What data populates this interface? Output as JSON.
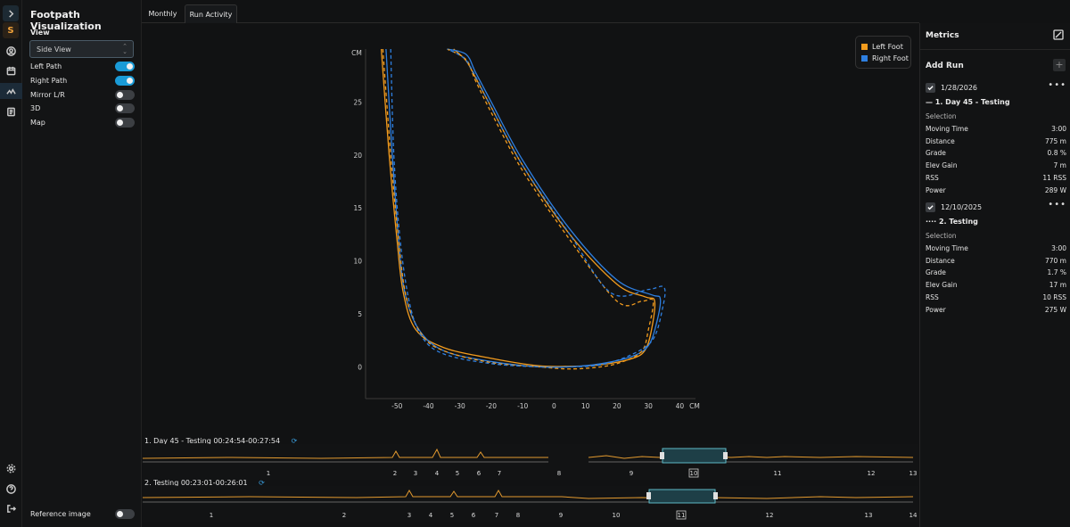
{
  "app": {
    "title": "Footpath Visualization",
    "logo_letter": "S"
  },
  "rail": {
    "top_icons": [
      "expand-icon",
      "logo",
      "user-icon",
      "calendar-icon",
      "activity-icon",
      "notes-icon"
    ],
    "bottom_icons": [
      "settings-icon",
      "help-icon",
      "logout-icon"
    ]
  },
  "view": {
    "label": "View",
    "selected": "Side View"
  },
  "toggles": [
    {
      "label": "Left Path",
      "on": true
    },
    {
      "label": "Right Path",
      "on": true
    },
    {
      "label": "Mirror L/R",
      "on": false
    },
    {
      "label": "3D",
      "on": false
    },
    {
      "label": "Map",
      "on": false
    }
  ],
  "reference_image": {
    "label": "Reference image",
    "on": false
  },
  "tabs": [
    {
      "label": "Monthly",
      "active": false
    },
    {
      "label": "Run Activity",
      "active": true
    }
  ],
  "chart_data": {
    "type": "line",
    "title": "",
    "xlabel": "CM",
    "ylabel": "CM",
    "xlim": [
      -60,
      45
    ],
    "ylim": [
      -3,
      30
    ],
    "x_ticks": [
      -50,
      -40,
      -30,
      -20,
      -10,
      0,
      10,
      20,
      30,
      40
    ],
    "y_ticks": [
      0,
      5,
      10,
      15,
      20,
      25
    ],
    "grid": false,
    "legend_position": "top-right",
    "series": [
      {
        "name": "Left Foot",
        "run": 1,
        "style": "solid",
        "color": "#f39c1e",
        "x": [
          -55,
          -52.5,
          -50,
          -48,
          -44,
          -35,
          -20,
          -5,
          5,
          15,
          25,
          29,
          31,
          32,
          29,
          20,
          5,
          -10,
          -20,
          -25,
          -28,
          -32
        ],
        "y": [
          30,
          20,
          12,
          7,
          3.5,
          1.8,
          0.8,
          0.1,
          0.05,
          0.2,
          0.8,
          1.6,
          3.5,
          6.2,
          6.6,
          7.8,
          12.5,
          19,
          24.5,
          27.3,
          28.9,
          30
        ]
      },
      {
        "name": "Right Foot",
        "run": 1,
        "style": "solid",
        "color": "#2e7fe0",
        "x": [
          -53.5,
          -51.5,
          -49.5,
          -47.5,
          -43,
          -35,
          -20,
          -5,
          5,
          15,
          25,
          30,
          32.5,
          33.8,
          31,
          20,
          5,
          -10,
          -20,
          -25,
          -28,
          -34
        ],
        "y": [
          30,
          20,
          12,
          7,
          3.5,
          1.5,
          0.5,
          0,
          0,
          0.3,
          1,
          2,
          4,
          6.4,
          6.8,
          8.2,
          13,
          19.5,
          25,
          27.8,
          29.5,
          30
        ]
      },
      {
        "name": "Left Foot",
        "run": 2,
        "style": "dashed",
        "color": "#f39c1e",
        "x": [
          -54.5,
          -52,
          -49.5,
          -47,
          -42,
          -35,
          -20,
          -5,
          5,
          15,
          22,
          28,
          30,
          31.5,
          28,
          20,
          5,
          -10,
          -20,
          -25,
          -28,
          -34
        ],
        "y": [
          30,
          20,
          12,
          6.5,
          3,
          1.5,
          0.4,
          0,
          -0.2,
          0,
          0.5,
          1.5,
          3.5,
          6.2,
          6.2,
          6.2,
          12,
          18.5,
          24,
          27,
          29,
          30
        ]
      },
      {
        "name": "Right Foot",
        "run": 2,
        "style": "dashed",
        "color": "#2e7fe0",
        "x": [
          -52,
          -51,
          -49,
          -46,
          -42,
          -35,
          -20,
          -5,
          5,
          15,
          25,
          31.5,
          34.5,
          35,
          30,
          18,
          5,
          -10,
          -20,
          -27,
          -30,
          -34
        ],
        "y": [
          30,
          20,
          12,
          6,
          2.8,
          1.2,
          0.3,
          0,
          0,
          0.2,
          1.2,
          2.6,
          5.5,
          7.5,
          7.3,
          7,
          12.5,
          19,
          24.5,
          28.5,
          29.4,
          30
        ]
      }
    ]
  },
  "legend": [
    {
      "label": "Left Foot",
      "color": "#f39c1e"
    },
    {
      "label": "Right Foot",
      "color": "#2e7fe0"
    }
  ],
  "metrics": {
    "title": "Metrics",
    "add_run_label": "Add Run",
    "runs": [
      {
        "date": "1/28/2026",
        "name": "— 1. Day 45 - Testing",
        "section": "Selection",
        "rows": [
          {
            "label": "Moving Time",
            "value": "3:00"
          },
          {
            "label": "Distance",
            "value": "775 m"
          },
          {
            "label": "Grade",
            "value": "0.8 %"
          },
          {
            "label": "Elev Gain",
            "value": "7 m"
          },
          {
            "label": "RSS",
            "value": "11 RSS"
          },
          {
            "label": "Power",
            "value": "289 W"
          }
        ]
      },
      {
        "date": "12/10/2025",
        "name": "···· 2. Testing",
        "section": "Selection",
        "rows": [
          {
            "label": "Moving Time",
            "value": "3:00"
          },
          {
            "label": "Distance",
            "value": "770 m"
          },
          {
            "label": "Grade",
            "value": "1.7 %"
          },
          {
            "label": "Elev Gain",
            "value": "17 m"
          },
          {
            "label": "RSS",
            "value": "10 RSS"
          },
          {
            "label": "Power",
            "value": "275 W"
          }
        ]
      }
    ]
  },
  "timelines": [
    {
      "title": "1. Day 45 - Testing 00:24:54-00:27:54",
      "ticks": [
        "1",
        "2",
        "3",
        "4",
        "5",
        "6",
        "7",
        "8",
        "9",
        "10",
        "11",
        "12",
        "13"
      ],
      "selected_tick": "10"
    },
    {
      "title": "2. Testing 00:23:01-00:26:01",
      "ticks": [
        "1",
        "2",
        "3",
        "4",
        "5",
        "6",
        "7",
        "8",
        "9",
        "10",
        "11",
        "12",
        "13",
        "14"
      ],
      "selected_tick": "11"
    }
  ]
}
